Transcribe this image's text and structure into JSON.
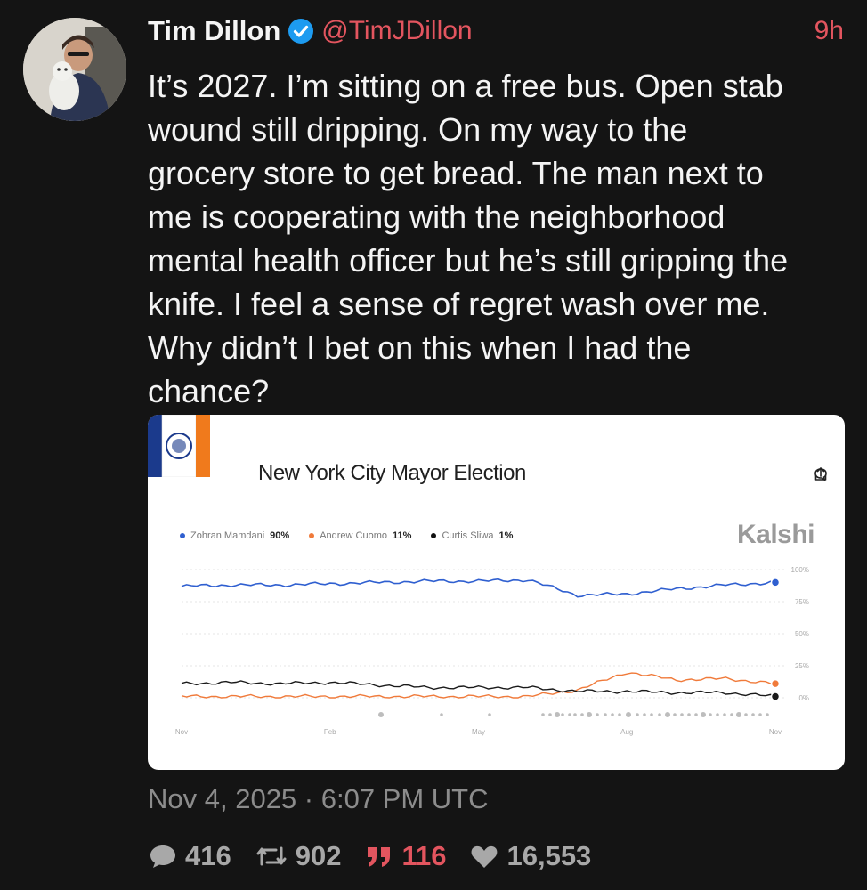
{
  "tweet": {
    "author_name": "Tim Dillon",
    "handle": "@TimJDillon",
    "time_ago": "9h",
    "text": "It’s 2027. I’m sitting on a free bus. Open stab\nwound still dripping. On my way to the\ngrocery store to get bread. The man next to\nme is cooperating with the neighborhood\nmental health officer but he’s still gripping the\nknife. I feel a sense of regret wash over me.\nWhy didn’t I bet on this when I had the\nchance?",
    "timestamp": "Nov 4, 2025 · 6:07 PM UTC",
    "stats": {
      "replies": "416",
      "retweets": "902",
      "quotes": "116",
      "likes": "16,553"
    }
  },
  "colors": {
    "background": "#141414",
    "accent": "#e3555f",
    "verified": "#1d9bf0",
    "mamdani": "#2f5fd0",
    "cuomo": "#f07a3a",
    "sliwa": "#1a1a1a"
  },
  "icons": [
    "verified-badge-icon",
    "reply-icon",
    "retweet-icon",
    "quote-icon",
    "heart-icon",
    "comment-icon",
    "share-icon"
  ],
  "card": {
    "title": "New York City Mayor Election",
    "brand": "Kalshi",
    "legend": [
      {
        "name": "Zohran Mamdani",
        "value": "90%"
      },
      {
        "name": "Andrew Cuomo",
        "value": "11%"
      },
      {
        "name": "Curtis Sliwa",
        "value": "1%"
      }
    ]
  },
  "chart_data": {
    "type": "line",
    "title": "New York City Mayor Election",
    "x_ticks": [
      "Nov",
      "Feb",
      "May",
      "Aug",
      "Nov"
    ],
    "y_ticks": [
      "100%",
      "75%",
      "50%",
      "25%",
      "0%"
    ],
    "ylim": [
      0,
      100
    ],
    "grid": true,
    "legend_position": "top-left",
    "x": [
      0,
      1,
      2,
      3,
      4,
      5,
      6,
      7,
      8,
      9,
      10,
      11,
      12
    ],
    "series": [
      {
        "name": "Zohran Mamdani",
        "values": [
          87,
          88,
          88,
          89,
          90,
          91,
          91,
          92,
          80,
          81,
          85,
          88,
          90
        ]
      },
      {
        "name": "Andrew Cuomo",
        "values": [
          1,
          1,
          1,
          1,
          1,
          1,
          1,
          1,
          6,
          20,
          14,
          15,
          11
        ]
      },
      {
        "name": "Curtis Sliwa",
        "values": [
          11,
          12,
          11,
          12,
          10,
          8,
          8,
          8,
          5,
          5,
          4,
          4,
          1
        ]
      }
    ]
  }
}
